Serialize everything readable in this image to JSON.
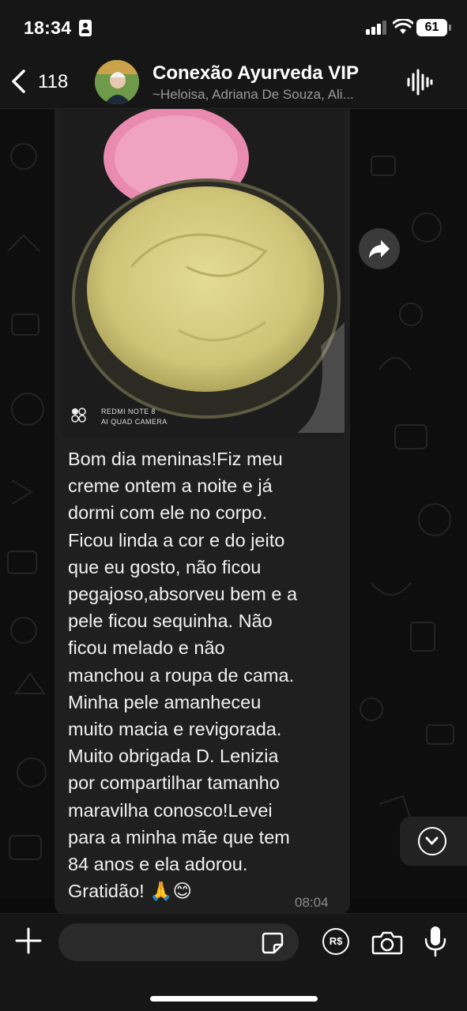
{
  "status_bar": {
    "time": "18:34",
    "battery": "61"
  },
  "header": {
    "back_count": "118",
    "group_name": "Conexão Ayurveda VIP",
    "members": "~Heloisa, Adriana De Souza, Ali..."
  },
  "message": {
    "camera_watermark_line1": "REDMI NOTE 8",
    "camera_watermark_line2": "AI QUAD CAMERA",
    "lines": [
      "Bom dia meninas!Fiz meu",
      "creme ontem a noite e já",
      "dormi com ele no corpo.",
      "Ficou linda a cor e do jeito",
      "que eu gosto, não ficou",
      "pegajoso,absorveu bem e a",
      "pele ficou sequinha. Não",
      "ficou melado e não",
      "manchou a roupa de cama.",
      "Minha pele amanheceu",
      "muito macia e revigorada.",
      "Muito obrigada D. Lenizia",
      "por compartilhar tamanho",
      "maravilha conosco!Levei",
      "para a minha mãe que tem",
      "84 anos e ela adorou.",
      "Gratidão! 🙏😊"
    ],
    "time": "08:04"
  },
  "composer": {
    "input_value": "",
    "pix_label": "R$"
  },
  "colors": {
    "bubble": "#1f1f1f",
    "bar": "#161616",
    "cream": "#d8cf86"
  },
  "icons": [
    "back-chevron-icon",
    "audio-wave-icon",
    "forward-icon",
    "chevron-down-icon",
    "plus-icon",
    "sticker-icon",
    "pix-icon",
    "camera-icon",
    "mic-icon"
  ]
}
